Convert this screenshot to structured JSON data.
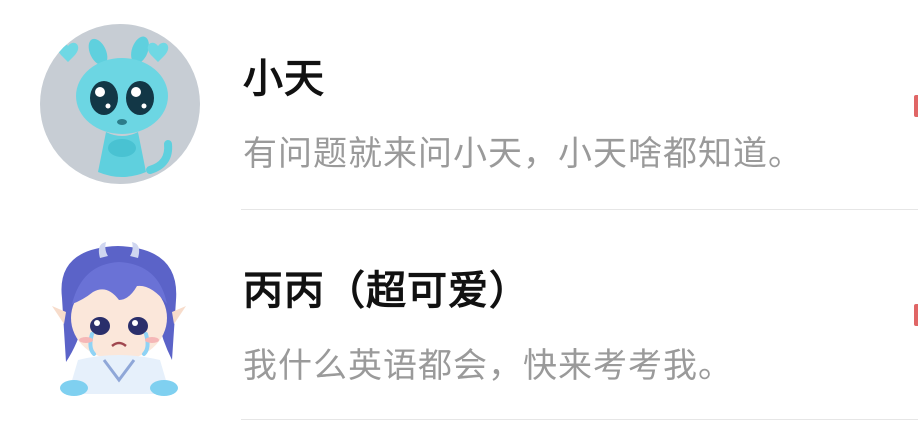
{
  "colors": {
    "name_text": "#111111",
    "description_text": "#9a9a9a",
    "divider": "#e6e6e6",
    "avatar_bg": "#c7cdd4",
    "edge_mark": "#e06666"
  },
  "contacts": [
    {
      "name": "小天",
      "description": "有问题就来问小天，小天啥都知道。",
      "avatar_icon": "teal-alien-mascot-icon"
    },
    {
      "name": "丙丙（超可爱）",
      "description": "我什么英语都会，快来考考我。",
      "avatar_icon": "crying-anime-character-icon"
    }
  ]
}
